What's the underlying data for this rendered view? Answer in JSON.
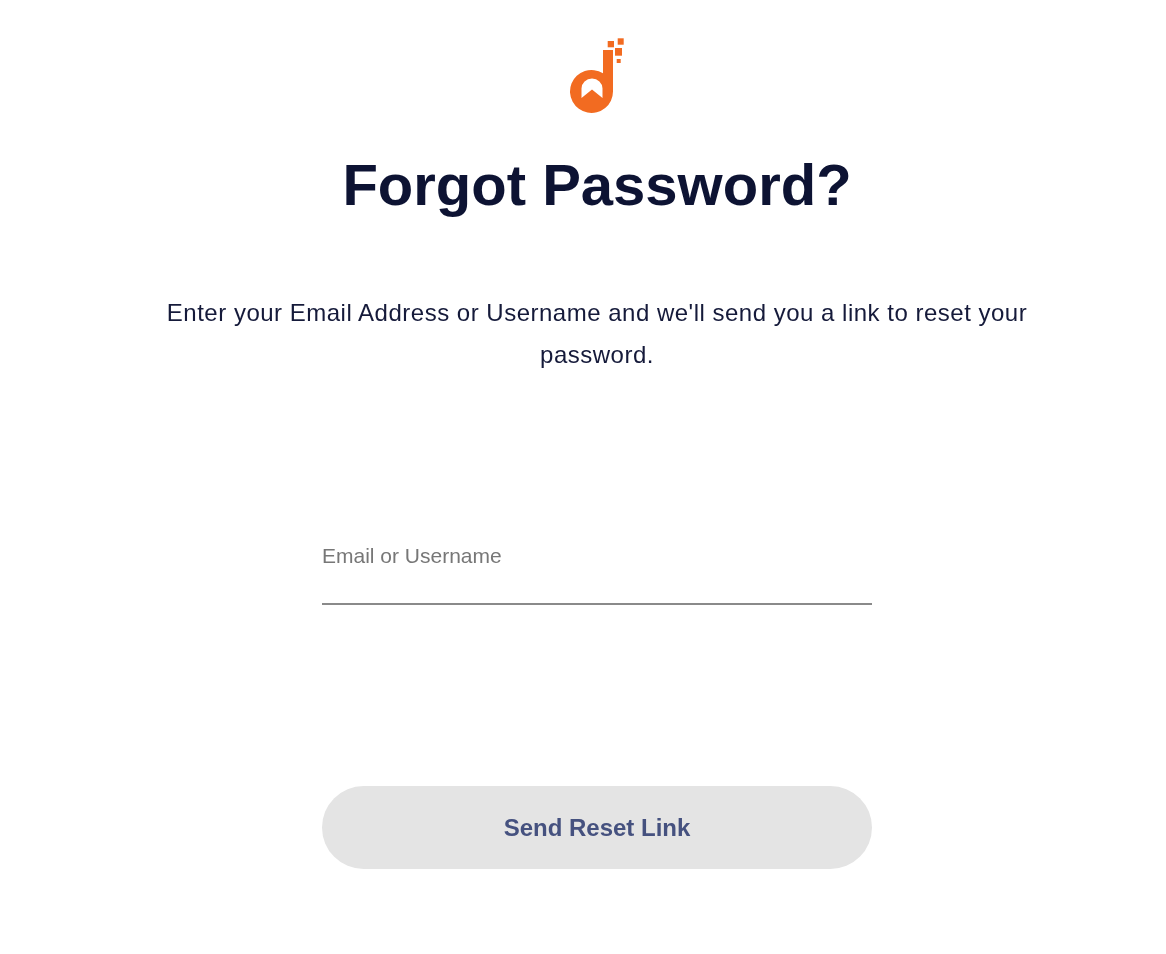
{
  "heading": "Forgot Password?",
  "description": "Enter your Email Address or Username and we'll send you a link to reset your password.",
  "form": {
    "email_field": {
      "placeholder": "Email or Username"
    },
    "submit_button": {
      "label": "Send Reset Link",
      "disabled": true
    }
  }
}
